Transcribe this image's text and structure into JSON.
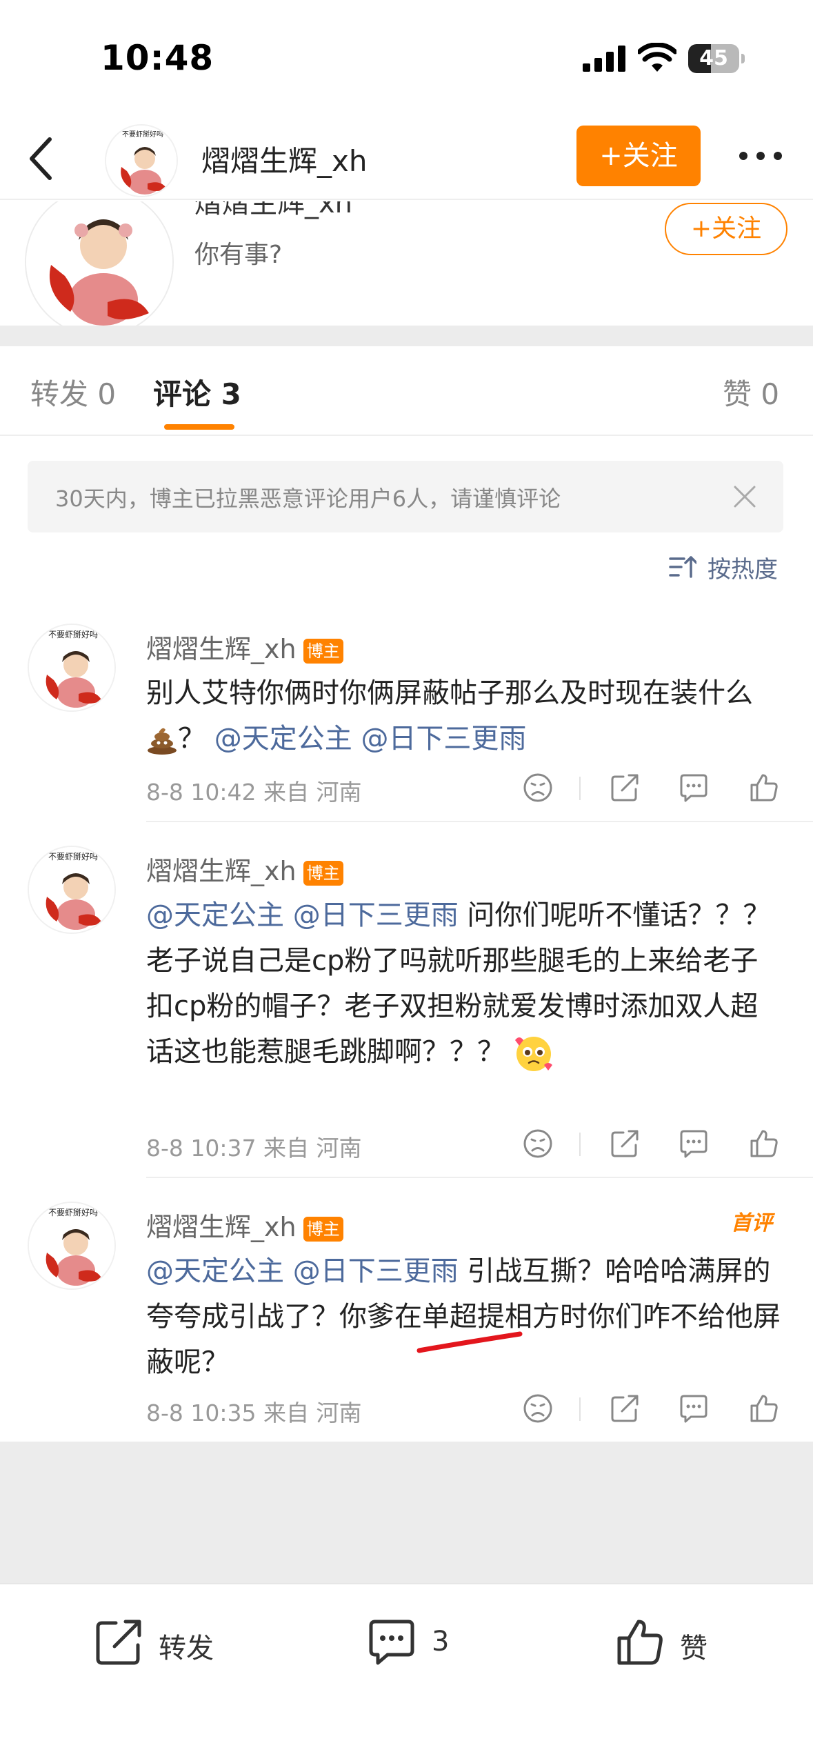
{
  "status_bar": {
    "time": "10:48",
    "battery": "45",
    "battery_level": 0.45
  },
  "nav": {
    "title": "熠熠生辉_xh",
    "follow_label": "+关注"
  },
  "post_header": {
    "name": "熠熠生辉_xh",
    "desc": "你有事?",
    "follow_label": "+关注"
  },
  "tabs": [
    {
      "label": "转发 0"
    },
    {
      "label": "评论 3"
    },
    {
      "label": "赞 0"
    }
  ],
  "notice": {
    "text": "30天内，博主已拉黑恶意评论用户6人，请谨慎评论"
  },
  "sort": {
    "label": "按热度"
  },
  "avatar_caption": "不要虾掰好吗",
  "comments": [
    {
      "author": "熠熠生辉_xh",
      "badge": "博主",
      "text_1": "别人艾特你俩时你俩屏蔽帖子那么及时现在装什么",
      "text_2": "？",
      "mention_1": "@天定公主",
      "mention_2": "@日下三更雨",
      "meta": "8-8 10:42  来自 河南"
    },
    {
      "author": "熠熠生辉_xh",
      "badge": "博主",
      "mention_1": "@天定公主",
      "mention_2": "@日下三更雨",
      "text": " 问你们呢听不懂话？？？ 老子说自己是cp粉了吗就听那些腿毛的上来给老子扣cp粉的帽子？老子双担粉就爱发博时添加双人超话这也能惹腿毛跳脚啊？？？",
      "meta": "8-8 10:37  来自 河南"
    },
    {
      "author": "熠熠生辉_xh",
      "badge": "博主",
      "first_badge": "首评",
      "mention_1": "@天定公主",
      "mention_2": "@日下三更雨",
      "text": " 引战互撕？哈哈哈满屏的夸夸成引战了？你爹在单超提相方时你们咋不给他屏蔽呢？",
      "meta": "8-8 10:35  来自 河南"
    }
  ],
  "bottom_bar": {
    "repost_label": "转发",
    "comment_count": "3",
    "like_label": "赞"
  },
  "colors": {
    "accent": "#ff8200",
    "mention": "#4d6a9c"
  }
}
